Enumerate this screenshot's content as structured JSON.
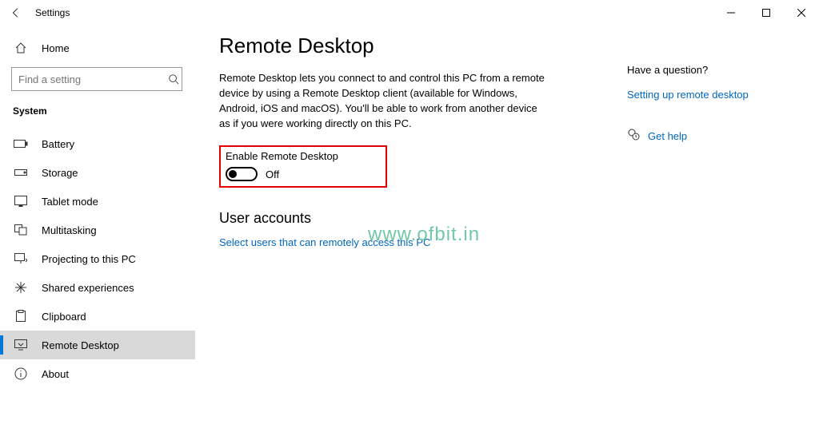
{
  "window": {
    "app_title": "Settings"
  },
  "sidebar": {
    "home_label": "Home",
    "search_placeholder": "Find a setting",
    "group_label": "System",
    "items": [
      {
        "label": "Battery"
      },
      {
        "label": "Storage"
      },
      {
        "label": "Tablet mode"
      },
      {
        "label": "Multitasking"
      },
      {
        "label": "Projecting to this PC"
      },
      {
        "label": "Shared experiences"
      },
      {
        "label": "Clipboard"
      },
      {
        "label": "Remote Desktop"
      },
      {
        "label": "About"
      }
    ]
  },
  "page": {
    "title": "Remote Desktop",
    "description": "Remote Desktop lets you connect to and control this PC from a remote device by using a Remote Desktop client (available for Windows, Android, iOS and macOS). You'll be able to work from another device as if you were working directly on this PC.",
    "enable_label": "Enable Remote Desktop",
    "toggle_state": "Off",
    "user_accounts_heading": "User accounts",
    "select_users_link": "Select users that can remotely access this PC"
  },
  "right": {
    "question_heading": "Have a question?",
    "setup_link": "Setting up remote desktop",
    "get_help_label": "Get help"
  },
  "watermark": "www.ofbit.in"
}
